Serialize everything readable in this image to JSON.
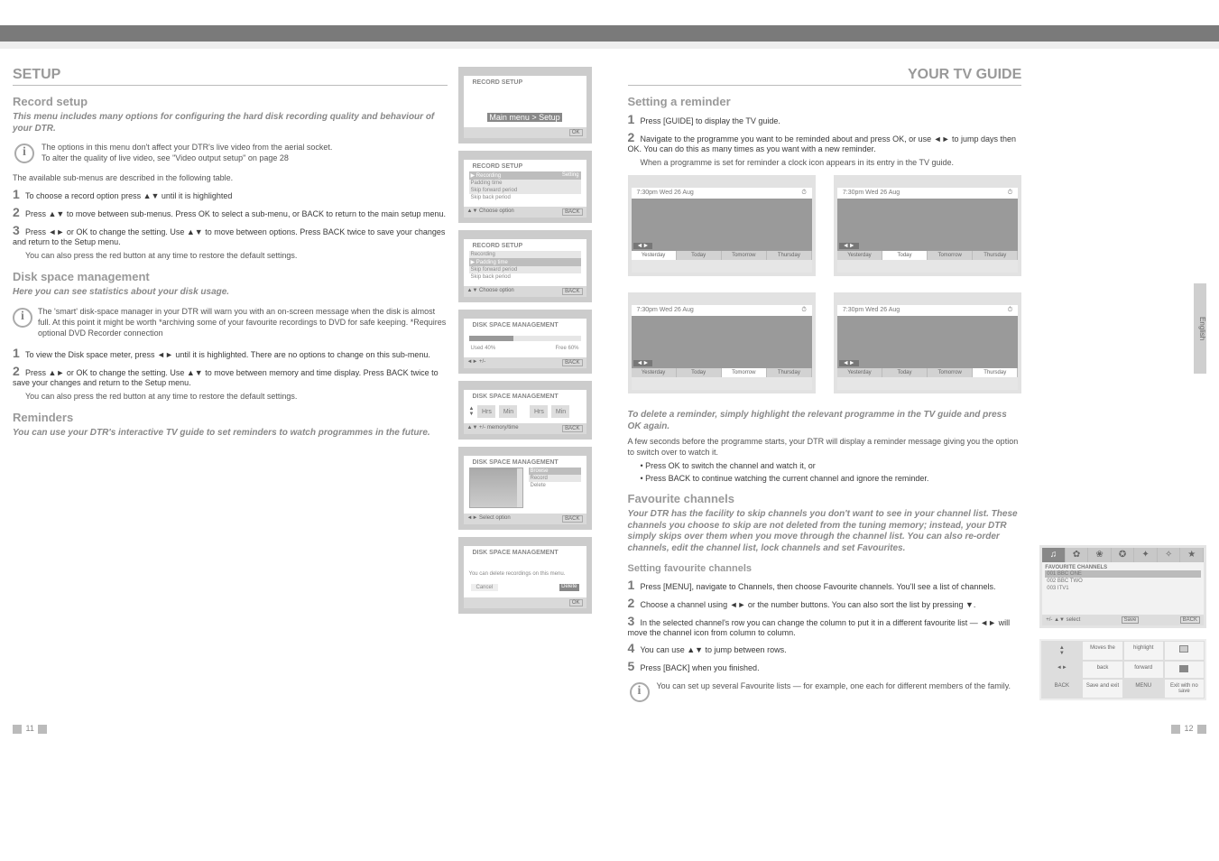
{
  "left": {
    "title": "SETUP",
    "record_heading": "Record setup",
    "record_lead": "This menu includes many options for configuring the hard disk recording quality and behaviour of your DTR.",
    "hint1_line1": "The options in this menu don't affect your DTR's live video from the aerial socket.",
    "hint1_line2": "To alter the quality of live video, see \"Video output setup\" on page 28",
    "table_intro": "The available sub-menus are described in the following table.",
    "sub_disk": "Disk space management",
    "disk_lead": "Here you can see statistics about your disk usage.",
    "hint2": "The 'smart' disk-space manager in your DTR will warn you with an on-screen message when the disk is almost full. At this point it might be worth *archiving some of your favourite recordings to DVD for safe keeping. *Requires optional DVD Recorder connection",
    "reminders_heading": "Reminders",
    "reminders_lead": "You can use your DTR's interactive TV guide to set reminders to watch programmes in the future."
  },
  "steps_col1": [
    "To choose a record option press ▲▼ until it is highlighted",
    "Press ▲▼ to move between sub-menus. Press OK to select a sub-menu, or BACK to return to the main setup menu.",
    "Press ◄► or OK to change the setting. Use ▲▼ to move between options. Press BACK twice to save your changes and return to the Setup menu.",
    "You can also press the red button at any time to restore the default settings."
  ],
  "disk_steps": [
    "To view the Disk space meter, press ◄► until it is highlighted. There are no options to change on this sub-menu.",
    "Press ▲► or OK to change the setting. Use ▲▼ to move between memory and time display. Press BACK twice to save your changes and return to the Setup menu.",
    "You can also press the red button at any time to restore the default settings."
  ],
  "screens": {
    "s1": {
      "title": "RECORD SETUP",
      "menu": "Main menu > Setup",
      "ok": "OK"
    },
    "s2": {
      "title": "RECORD SETUP",
      "rows": [
        [
          "▶ Recording",
          "Setting"
        ],
        [
          "  Padding time",
          ""
        ],
        [
          "  Skip forward period",
          ""
        ],
        [
          "  Skip back period",
          ""
        ]
      ],
      "foot_left": "▲▼ Choose option",
      "foot_right": "BACK"
    },
    "s3": {
      "title": "RECORD SETUP",
      "rows": [
        [
          "  Recording",
          "Setting"
        ],
        [
          "▶ Padding time",
          ""
        ],
        [
          "  Skip forward period",
          ""
        ],
        [
          "  Skip back period",
          ""
        ]
      ],
      "foot_left": "▲▼ Choose option",
      "foot_right": "BACK"
    },
    "s4": {
      "title": "DISK SPACE MANAGEMENT",
      "used": "Used",
      "usedv": "40%",
      "free": "Free",
      "freev": "60%",
      "foot_left": "◄►  +/-",
      "foot_right": "BACK"
    },
    "s5": {
      "title": "DISK SPACE MANAGEMENT",
      "labels": [
        "Hrs",
        "Min",
        "Hrs",
        "Min"
      ],
      "foot_left": "▲▼  +/-  memory/time",
      "foot_right": "BACK"
    },
    "s6": {
      "title": "DISK SPACE MANAGEMENT",
      "optA": "Browse",
      "optB": "Record",
      "optC": "Delete",
      "foot_left": "◄► Select option",
      "foot_right": "BACK"
    },
    "s7": {
      "title": "DISK SPACE MANAGEMENT",
      "warn": "You can delete recordings on this menu.",
      "cancel": "Cancel",
      "ok": "Delete",
      "foot": "OK"
    }
  },
  "right": {
    "mid_heading": "YOUR TV GUIDE",
    "set_rem": {
      "title": "Setting a reminder",
      "s1": "Press [GUIDE] to display the TV guide.",
      "s2": "Navigate to the programme you want to be reminded about and press OK, or use ◄► to jump days then OK. You can do this as many times as you want with a new reminder.",
      "note": "When a programme is set for reminder a clock icon appears in its entry in the TV guide.",
      "del_lead": "To delete a reminder, simply highlight the relevant programme in the TV guide and press OK again.",
      "later": "A few seconds before the programme starts, your DTR will display a reminder message giving you the option to switch over to watch it.",
      "prompt1": "Press OK to switch the channel and watch it, or",
      "prompt2": "Press BACK to continue watching the current channel and ignore the reminder."
    },
    "wide": {
      "tleft": "7:30pm  Wed 26 Aug",
      "tabs": [
        "Yesterday",
        "Today",
        "Tomorrow",
        "Thursday"
      ]
    },
    "pg11": "11",
    "fav": {
      "heading": "Favourite channels",
      "lead": "Your DTR has the facility to skip channels you don't want to see in your channel list. These channels you choose to skip are not deleted from the tuning memory; instead, your DTR simply skips over them when you move through the channel list. You can also re-order channels, edit the channel list, lock channels and set Favourites.",
      "sub": "Setting favourite channels",
      "steps": [
        "Press [MENU], navigate to Channels, then choose Favourite channels. You'll see a list of channels.",
        "Choose a channel using ◄► or the number buttons. You can also sort the list by pressing ▼.",
        "In the selected channel's row you can change the column to put it in a different favourite list — ◄► will move the channel icon from column to column.",
        "You can use ▲▼ to jump between rows.",
        "Press [BACK] when you finished."
      ],
      "hint": "You can set up several Favourite lists — for example, one each for different members of the family.",
      "sublists_title": "FAVOURITE CHANNELS",
      "list_items": [
        "001  BBC ONE",
        "002  BBC TWO",
        "003  ITV1"
      ],
      "foot_l": "+/- ▲▼  select",
      "foot_m": "Save",
      "foot_r": "BACK",
      "tbl": [
        [
          "▲▼",
          "Moves the",
          "highlight",
          "□"
        ],
        [
          "◄►",
          "back",
          "forward",
          "■"
        ],
        [
          "BACK",
          "Save and exit",
          "MENU",
          "Exit with no save"
        ]
      ]
    },
    "pg12": "12",
    "side": "English"
  }
}
